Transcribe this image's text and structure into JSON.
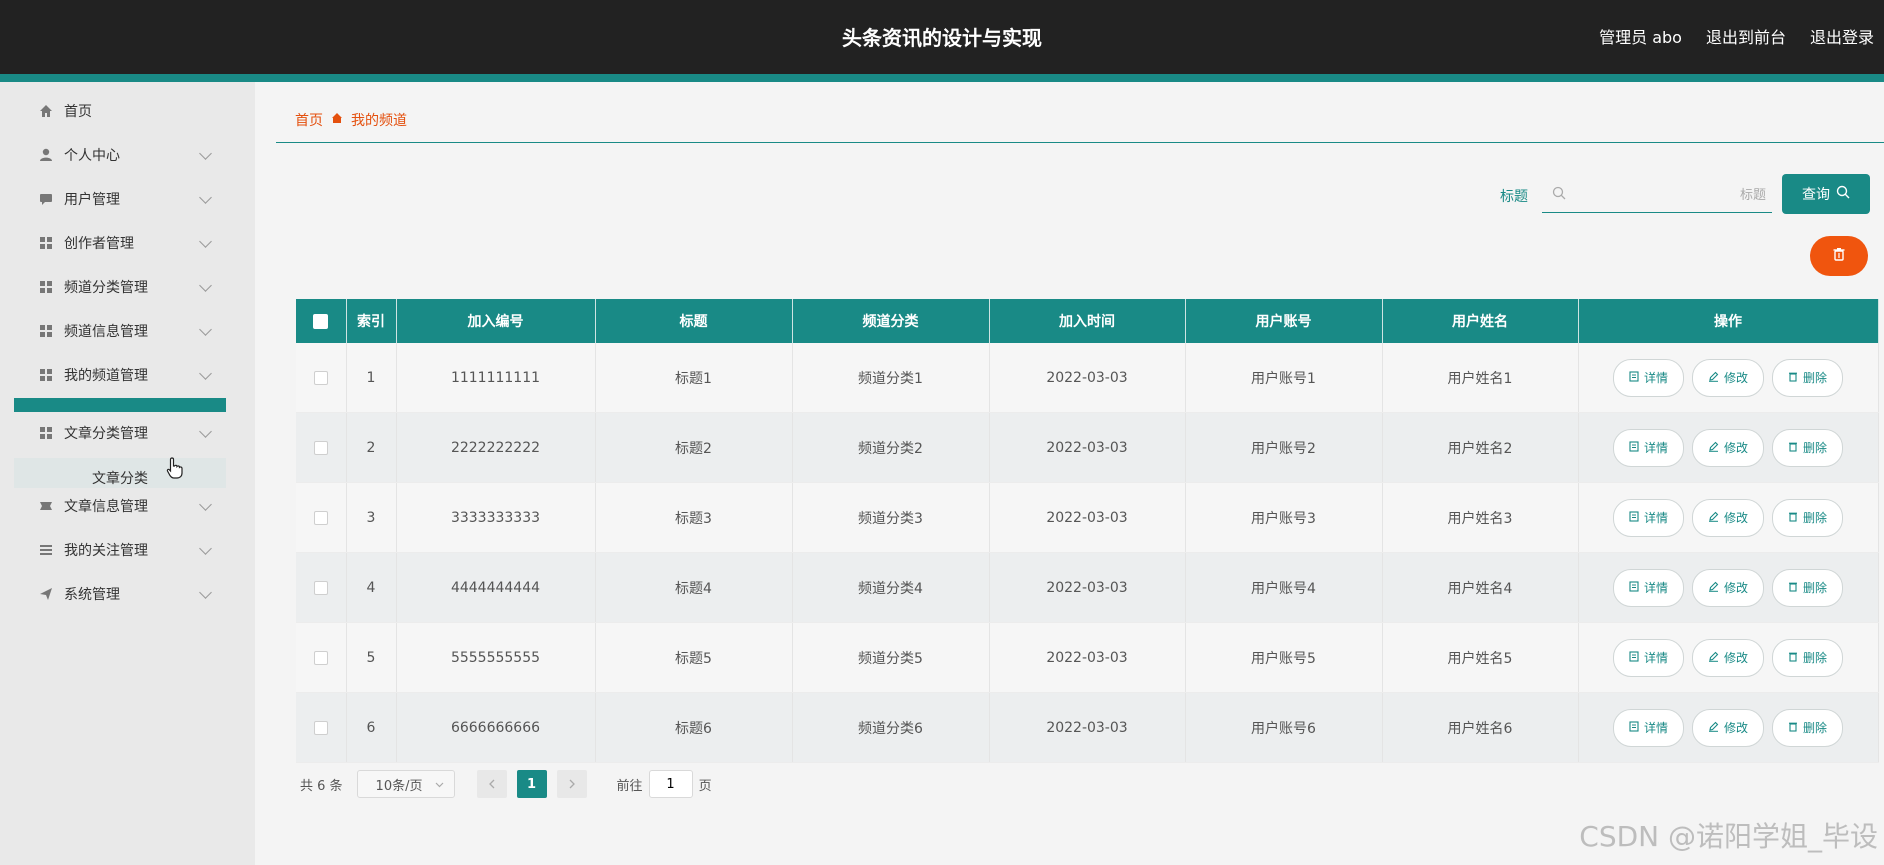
{
  "header": {
    "title": "头条资讯的设计与实现",
    "links": [
      "管理员 abo",
      "退出到前台",
      "退出登录"
    ]
  },
  "sidebar": {
    "items": [
      {
        "label": "首页",
        "icon": "home-icon"
      },
      {
        "label": "个人中心",
        "icon": "user-icon"
      },
      {
        "label": "用户管理",
        "icon": "chat-icon"
      },
      {
        "label": "创作者管理",
        "icon": "grid-icon"
      },
      {
        "label": "频道分类管理",
        "icon": "grid-icon"
      },
      {
        "label": "频道信息管理",
        "icon": "grid-icon"
      },
      {
        "label": "我的频道管理",
        "icon": "grid-icon"
      },
      {
        "label": "文章分类管理",
        "icon": "grid-icon"
      },
      {
        "label": "文章信息管理",
        "icon": "ticket-icon"
      },
      {
        "label": "我的关注管理",
        "icon": "list-icon"
      },
      {
        "label": "系统管理",
        "icon": "send-icon"
      }
    ],
    "submenu_item": "文章分类"
  },
  "breadcrumb": {
    "home": "首页",
    "current": "我的频道"
  },
  "search": {
    "label": "标题",
    "placeholder": "标题",
    "button": "查询"
  },
  "table": {
    "columns": [
      "索引",
      "加入编号",
      "标题",
      "频道分类",
      "加入时间",
      "用户账号",
      "用户姓名",
      "操作"
    ],
    "rows": [
      {
        "index": "1",
        "code": "1111111111",
        "title": "标题1",
        "category": "频道分类1",
        "time": "2022-03-03",
        "account": "用户账号1",
        "name": "用户姓名1"
      },
      {
        "index": "2",
        "code": "2222222222",
        "title": "标题2",
        "category": "频道分类2",
        "time": "2022-03-03",
        "account": "用户账号2",
        "name": "用户姓名2"
      },
      {
        "index": "3",
        "code": "3333333333",
        "title": "标题3",
        "category": "频道分类3",
        "time": "2022-03-03",
        "account": "用户账号3",
        "name": "用户姓名3"
      },
      {
        "index": "4",
        "code": "4444444444",
        "title": "标题4",
        "category": "频道分类4",
        "time": "2022-03-03",
        "account": "用户账号4",
        "name": "用户姓名4"
      },
      {
        "index": "5",
        "code": "5555555555",
        "title": "标题5",
        "category": "频道分类5",
        "time": "2022-03-03",
        "account": "用户账号5",
        "name": "用户姓名5"
      },
      {
        "index": "6",
        "code": "6666666666",
        "title": "标题6",
        "category": "频道分类6",
        "time": "2022-03-03",
        "account": "用户账号6",
        "name": "用户姓名6"
      }
    ],
    "actions": {
      "detail": "详情",
      "edit": "修改",
      "delete": "删除"
    }
  },
  "pagination": {
    "total": "共 6 条",
    "page_size": "10条/页",
    "current_page": "1",
    "goto_label": "前往",
    "goto_value": "1",
    "page_suffix": "页"
  },
  "watermark": "CSDN @诺阳学姐_毕设",
  "colors": {
    "primary": "#198a86",
    "accent": "#f0550e",
    "topbar": "#222222"
  }
}
